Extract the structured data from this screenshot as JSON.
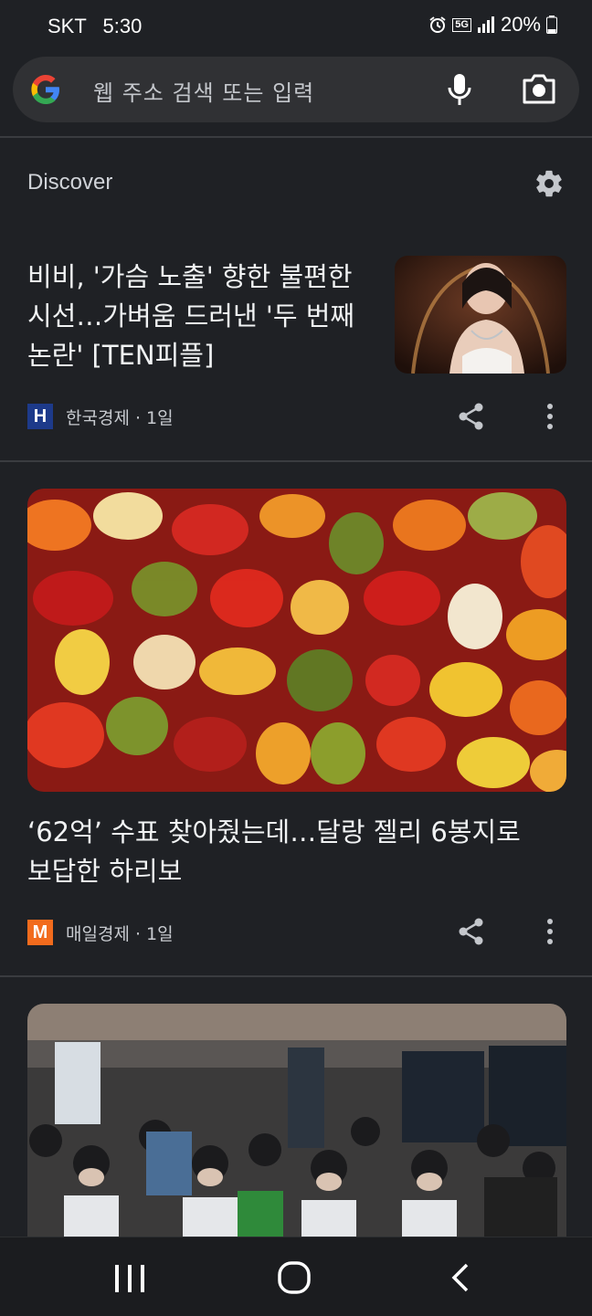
{
  "status_bar": {
    "carrier": "SKT",
    "time": "5:30",
    "network": "5G",
    "battery": "20%"
  },
  "search": {
    "placeholder": "웹 주소 검색 또는 입력"
  },
  "discover": {
    "title": "Discover"
  },
  "cards": [
    {
      "title_lines": [
        "비비, '가슴 노출' 향한 불편한",
        "시선…가벼움 드러낸 '두 번째",
        "논란' [TEN피플]"
      ],
      "source_logo": "H",
      "source_logo_color": "#1d3a8a",
      "source": "한국경제 · 1일"
    },
    {
      "title_lines": [
        "‘62억’ 수표 찾아줬는데…달랑 젤리 6봉지로",
        "보답한 하리보"
      ],
      "source_logo": "M",
      "source_logo_color": "#f26b1d",
      "source": "매일경제 · 1일"
    }
  ],
  "icons": {
    "google": "google-g-icon",
    "mic": "mic-icon",
    "camera": "camera-icon",
    "settings": "gear-icon",
    "share": "share-icon",
    "more": "more-vert-icon",
    "nav_recents": "recents-icon",
    "nav_home": "home-icon",
    "nav_back": "back-icon"
  }
}
